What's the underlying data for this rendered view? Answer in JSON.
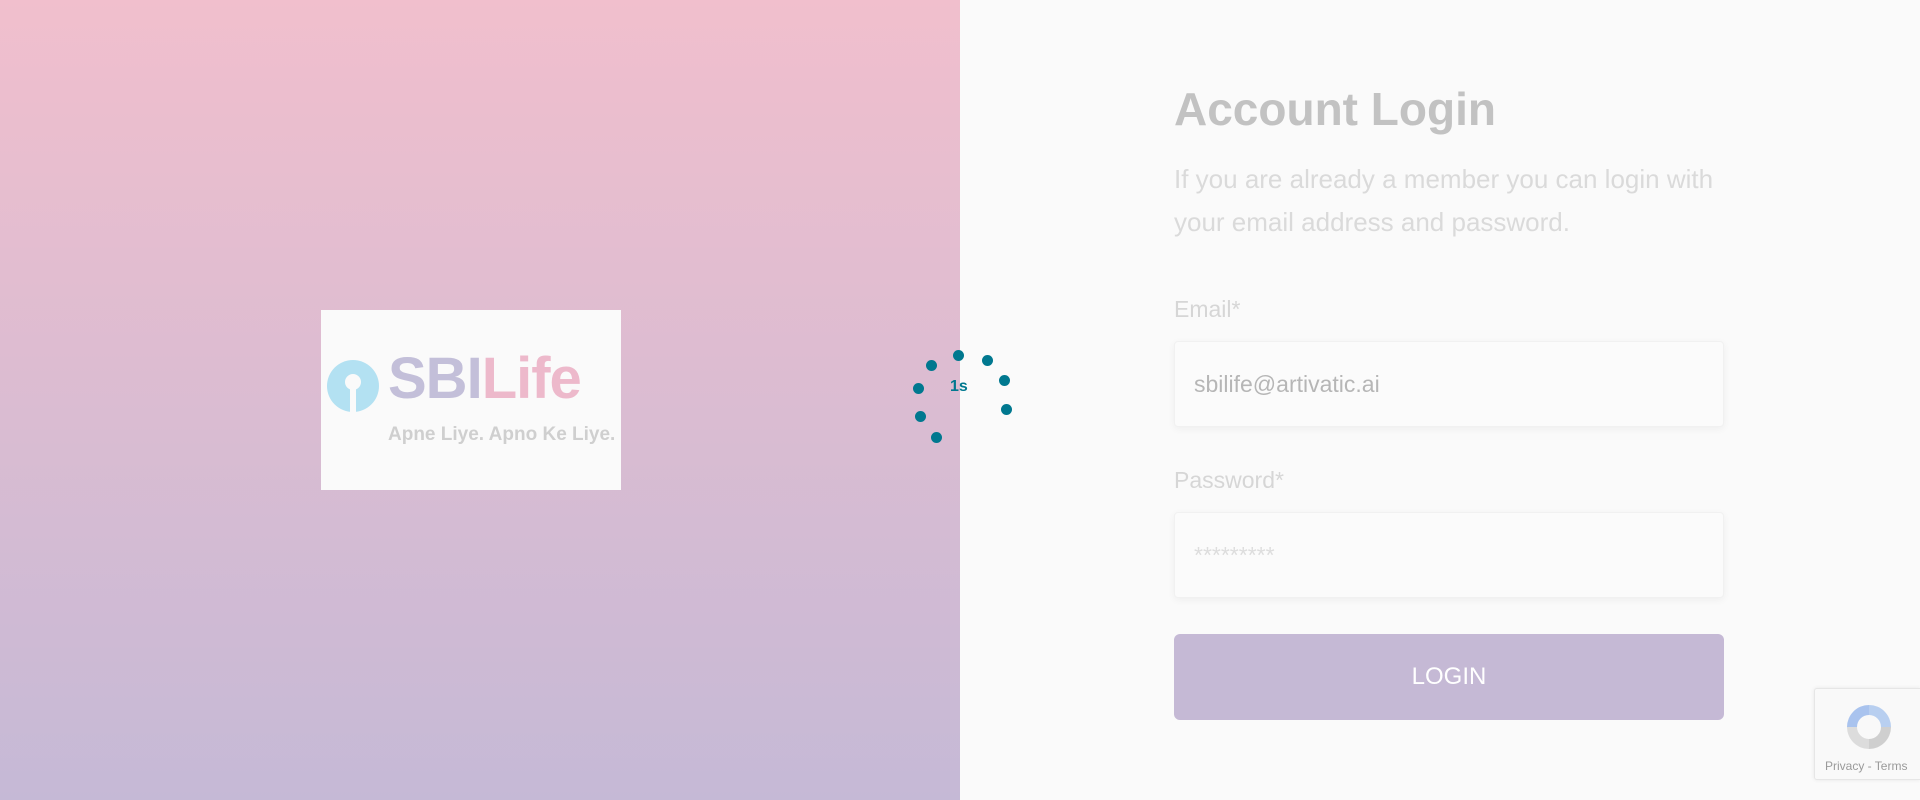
{
  "brand": {
    "logo_sbi": "SBI",
    "logo_life": "Life",
    "tagline": "Apne Liye. Apno Ke Liye."
  },
  "loader": {
    "label": "1s",
    "color": "#00788f"
  },
  "login": {
    "title": "Account Login",
    "subtitle": "If you are already a member you can login with your email address and password.",
    "email_label": "Email*",
    "email_value": "sbilife@artivatic.ai",
    "password_label": "Password*",
    "password_placeholder": "*********",
    "button_label": "LOGIN"
  },
  "recaptcha": {
    "privacy": "Privacy",
    "separator": " - ",
    "terms": "Terms"
  },
  "colors": {
    "gradient_top": "#f1bfcd",
    "gradient_bottom": "#c5b9d6",
    "button": "#c5b9d5",
    "background": "#fafafa"
  }
}
